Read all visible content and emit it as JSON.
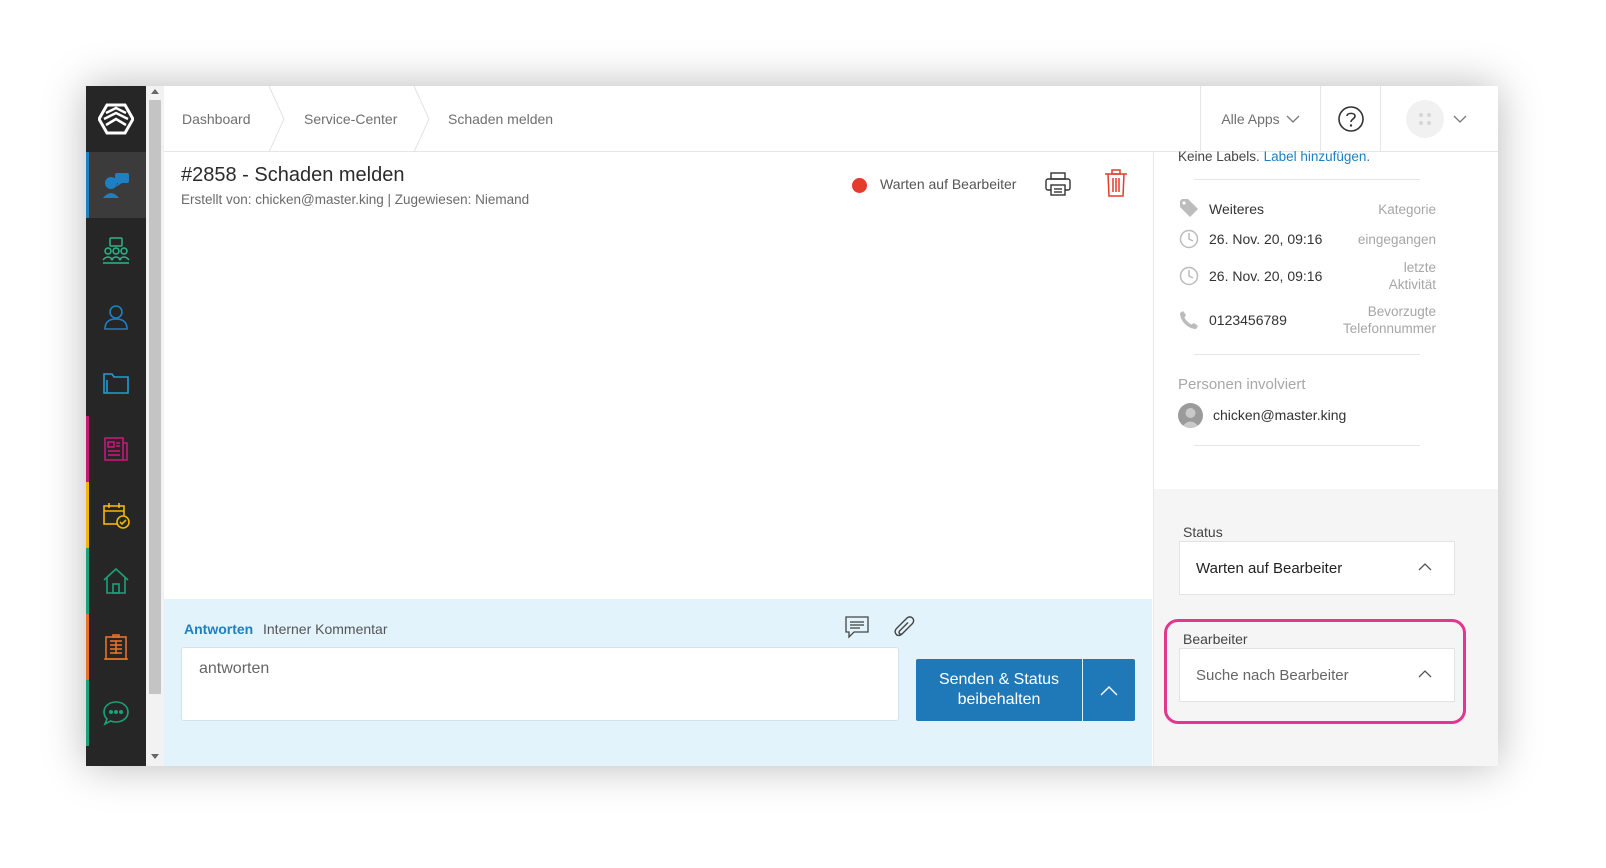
{
  "breadcrumbs": [
    "Dashboard",
    "Service-Center",
    "Schaden melden"
  ],
  "header": {
    "apps_label": "Alle Apps"
  },
  "ticket": {
    "title": "#2858 - Schaden melden",
    "subtitle": "Erstellt von: chicken@master.king | Zugewiesen: Niemand",
    "status": "Warten auf Bearbeiter"
  },
  "reply": {
    "tab_active": "Antworten",
    "tab_other": "Interner Kommentar",
    "input_value": "antworten",
    "send_label": "Senden & Status\nbeibehalten"
  },
  "sidebar": {
    "labels_text": "Keine Labels.",
    "labels_link": "Label hinzufügen.",
    "props": [
      {
        "icon": "tag-icon",
        "value": "Weiteres",
        "key": "Kategorie"
      },
      {
        "icon": "clock-icon",
        "value": "26. Nov. 20, 09:16",
        "key": "eingegangen"
      },
      {
        "icon": "clock-icon",
        "value": "26. Nov. 20, 09:16",
        "key": "letzte\nAktivität"
      },
      {
        "icon": "phone-icon",
        "value": "0123456789",
        "key": "Bevorzugte\nTelefonnummer"
      }
    ],
    "persons_title": "Personen involviert",
    "person": "chicken@master.king",
    "status_label": "Status",
    "status_value": "Warten auf Bearbeiter",
    "assignee_label": "Bearbeiter",
    "assignee_placeholder": "Suche nach Bearbeiter"
  },
  "colors": {
    "accent": "#1f78b8",
    "status_red": "#e53b2c",
    "highlight": "#e4368f",
    "rail": "#262626"
  }
}
